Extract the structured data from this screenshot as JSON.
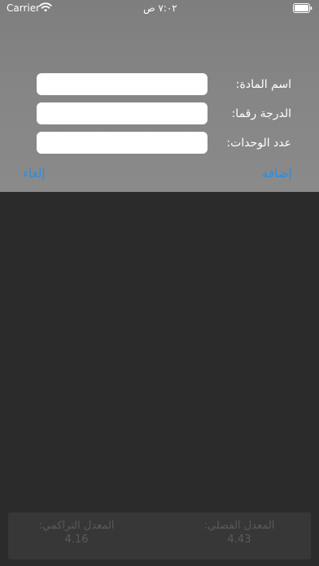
{
  "status_bar": {
    "carrier": "Carrier",
    "time": "٧:٠٢ ص"
  },
  "form": {
    "subject_name_label": "اسم المادة:",
    "grade_label": "الدرجة رقما:",
    "units_label": "عدد الوحدات:",
    "subject_name_value": "",
    "grade_value": "",
    "units_value": ""
  },
  "actions": {
    "add_label": "إضافة",
    "cancel_label": "إلغاء"
  },
  "summary": {
    "semester_gpa_label": "المعدل الفصلي:",
    "semester_gpa_value": "4.43",
    "cumulative_gpa_label": "المعدل التراكمي:",
    "cumulative_gpa_value": "4.16"
  },
  "colors": {
    "accent": "#2d8de0",
    "sheet": "#868686",
    "background": "#2b2b2b"
  }
}
